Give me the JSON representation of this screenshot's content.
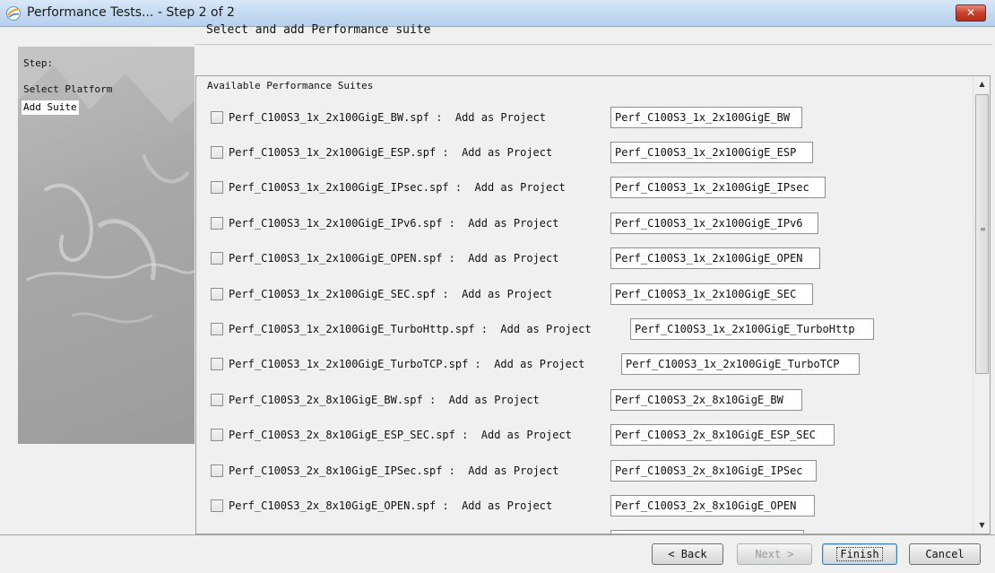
{
  "window": {
    "title": "Performance Tests... - Step 2 of 2",
    "close_label": "✕"
  },
  "wizard": {
    "step_heading": "Step:",
    "steps": [
      {
        "label": "Select Platform",
        "current": false
      },
      {
        "label": "Add Suite",
        "current": true
      }
    ]
  },
  "page": {
    "heading": "Select and add Performance suite",
    "group_label": "Available Performance Suites"
  },
  "suites": [
    {
      "label": "Perf_C100S3_1x_2x100GigE_BW.spf :  Add as Project",
      "project_name": "Perf_C100S3_1x_2x100GigE_BW"
    },
    {
      "label": "Perf_C100S3_1x_2x100GigE_ESP.spf :  Add as Project",
      "project_name": "Perf_C100S3_1x_2x100GigE_ESP"
    },
    {
      "label": "Perf_C100S3_1x_2x100GigE_IPsec.spf :  Add as Project",
      "project_name": "Perf_C100S3_1x_2x100GigE_IPsec"
    },
    {
      "label": "Perf_C100S3_1x_2x100GigE_IPv6.spf :  Add as Project",
      "project_name": "Perf_C100S3_1x_2x100GigE_IPv6"
    },
    {
      "label": "Perf_C100S3_1x_2x100GigE_OPEN.spf :  Add as Project",
      "project_name": "Perf_C100S3_1x_2x100GigE_OPEN"
    },
    {
      "label": "Perf_C100S3_1x_2x100GigE_SEC.spf :  Add as Project",
      "project_name": "Perf_C100S3_1x_2x100GigE_SEC"
    },
    {
      "label": "Perf_C100S3_1x_2x100GigE_TurboHttp.spf :  Add as Project",
      "project_name": "Perf_C100S3_1x_2x100GigE_TurboHttp"
    },
    {
      "label": "Perf_C100S3_1x_2x100GigE_TurboTCP.spf :  Add as Project",
      "project_name": "Perf_C100S3_1x_2x100GigE_TurboTCP"
    },
    {
      "label": "Perf_C100S3_2x_8x10GigE_BW.spf :  Add as Project",
      "project_name": "Perf_C100S3_2x_8x10GigE_BW"
    },
    {
      "label": "Perf_C100S3_2x_8x10GigE_ESP_SEC.spf :  Add as Project",
      "project_name": "Perf_C100S3_2x_8x10GigE_ESP_SEC"
    },
    {
      "label": "Perf_C100S3_2x_8x10GigE_IPSec.spf :  Add as Project",
      "project_name": "Perf_C100S3_2x_8x10GigE_IPSec"
    },
    {
      "label": "Perf_C100S3_2x_8x10GigE_OPEN.spf :  Add as Project",
      "project_name": "Perf_C100S3_2x_8x10GigE_OPEN"
    },
    {
      "label": "",
      "project_name": ""
    }
  ],
  "scrollbar": {
    "up_arrow": "▲",
    "down_arrow": "▼",
    "grip": "≡"
  },
  "buttons": {
    "back": "< Back",
    "next": "Next >",
    "finish": "Finish",
    "cancel": "Cancel"
  }
}
